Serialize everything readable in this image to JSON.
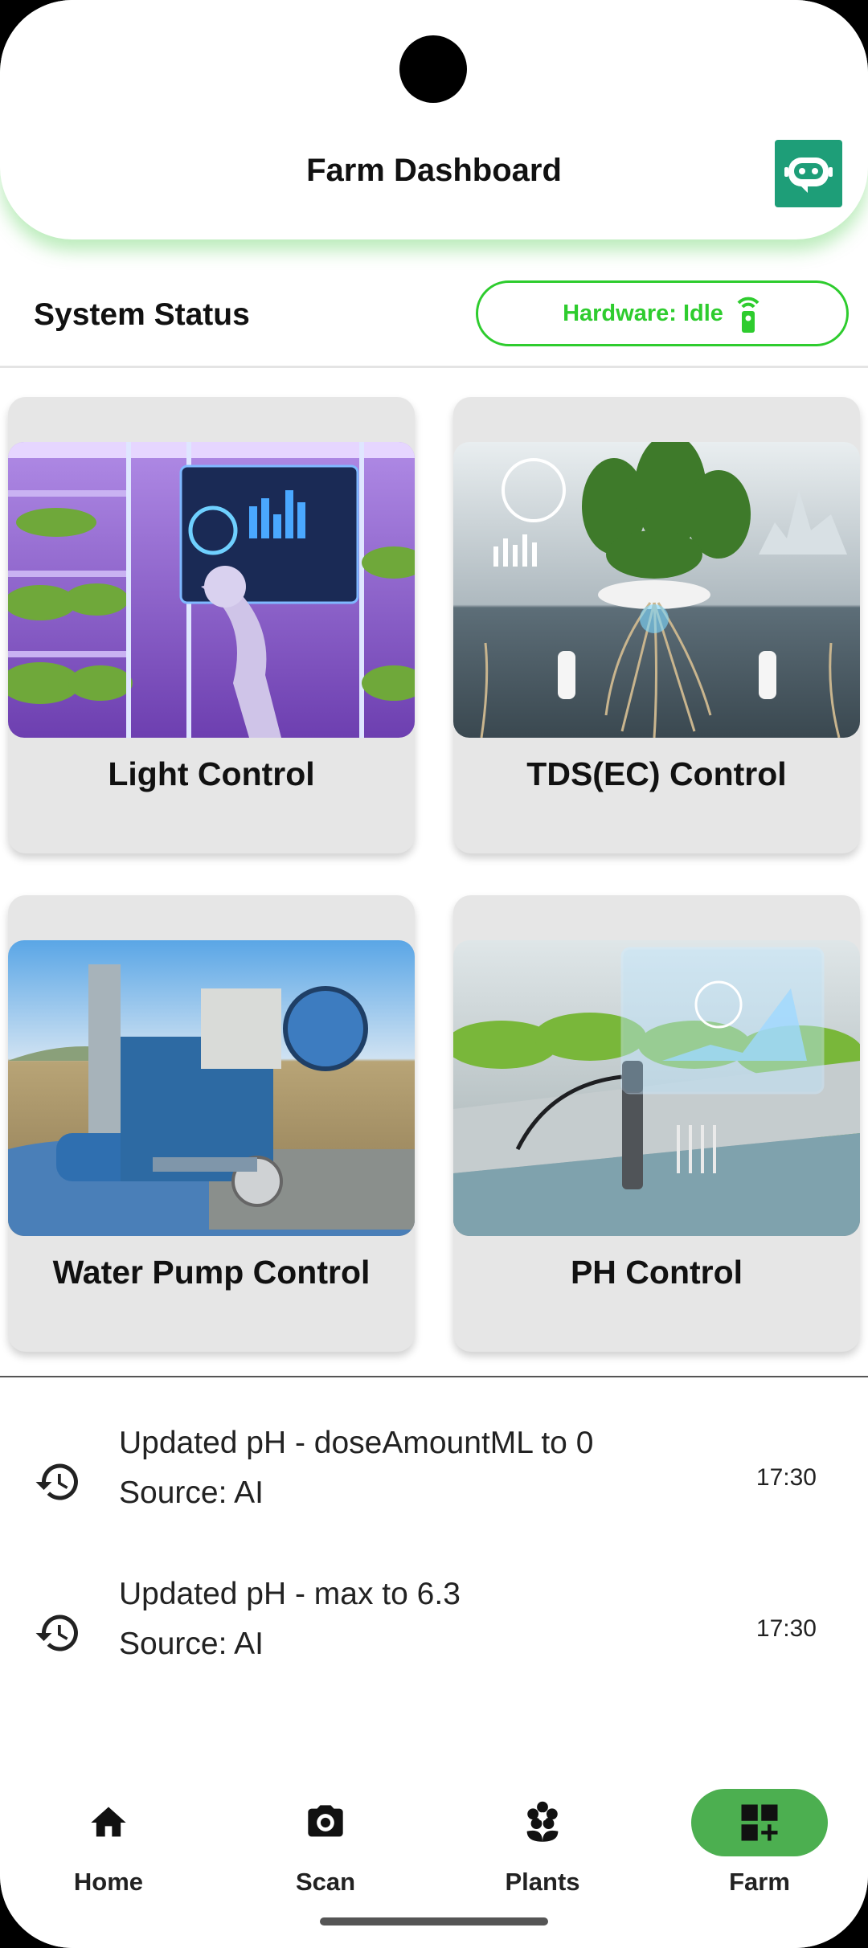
{
  "header": {
    "title": "Farm Dashboard",
    "assistant_icon": "chatbot-icon",
    "accent": "#1e9e78"
  },
  "status": {
    "label": "System Status",
    "hardware": "Hardware: Idle",
    "hardware_icon": "remote-signal-icon",
    "accent": "#2ecc2e"
  },
  "cards": [
    {
      "label": "Light Control",
      "image": "indoor-vertical-farm-robot-arm"
    },
    {
      "label": "TDS(EC) Control",
      "image": "hydroponic-plant-roots-with-ec-sensors"
    },
    {
      "label": "Water Pump Control",
      "image": "water-pump-machine-in-field"
    },
    {
      "label": "PH Control",
      "image": "ph-probe-in-lettuce-trough"
    }
  ],
  "logs": [
    {
      "text": "Updated pH - doseAmountML to 0",
      "source": "Source: AI",
      "time": "17:30",
      "icon": "history-icon"
    },
    {
      "text": "Updated pH - max to 6.3",
      "source": "Source: AI",
      "time": "17:30",
      "icon": "history-icon"
    }
  ],
  "nav": [
    {
      "label": "Home",
      "icon": "home-icon",
      "active": false
    },
    {
      "label": "Scan",
      "icon": "camera-icon",
      "active": false
    },
    {
      "label": "Plants",
      "icon": "flower-icon",
      "active": false
    },
    {
      "label": "Farm",
      "icon": "dashboard-add-icon",
      "active": true
    }
  ],
  "colors": {
    "nav_active": "#4caf50",
    "card_bg": "#e6e6e6"
  }
}
